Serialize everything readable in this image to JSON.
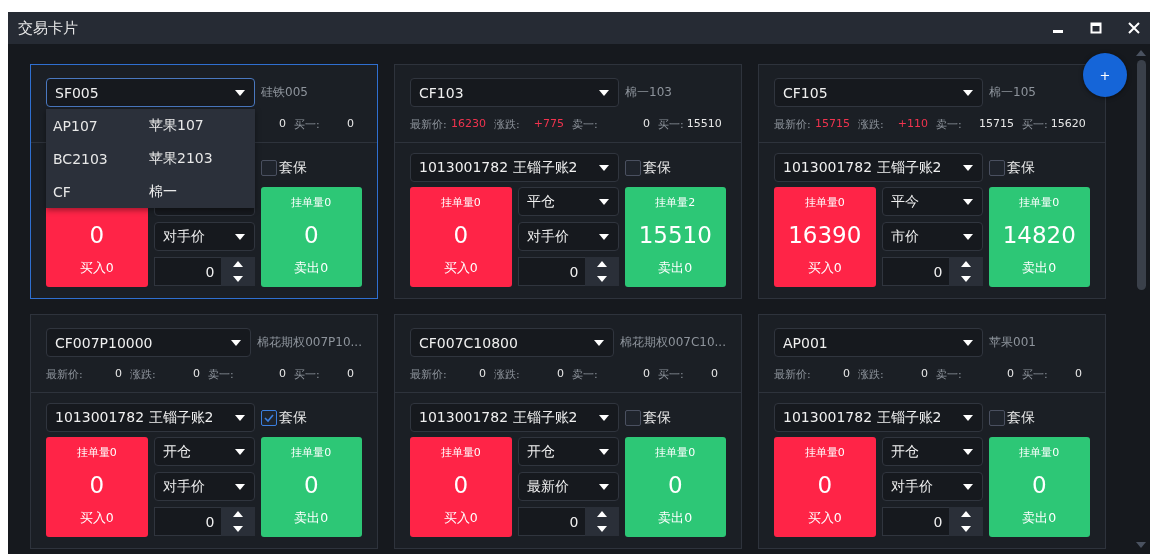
{
  "window": {
    "title": "交易卡片"
  },
  "fab": {
    "label": "+"
  },
  "cards": [
    {
      "selected": true,
      "symbol": "SF005",
      "name": "硅铁005",
      "quote": [
        {
          "value": "0",
          "rising": false
        },
        {
          "label": "买一:",
          "value": "0",
          "rising": false
        }
      ],
      "hedge": {
        "label": "套保",
        "checked": false
      },
      "buy": {
        "price": "0",
        "action": "买入0"
      },
      "price_type": "对手价",
      "quantity": "0",
      "sell": {
        "pending": "挂单量0",
        "price": "0",
        "action": "卖出0"
      },
      "dropdown": {
        "options": [
          {
            "code": "AP107",
            "name": "苹果107"
          },
          {
            "code": "BC2103",
            "name": "苹果2103"
          },
          {
            "code": "CF",
            "name": "棉一"
          }
        ]
      }
    },
    {
      "selected": false,
      "symbol": "CF103",
      "name": "棉一103",
      "quote": [
        {
          "label": "最新价:",
          "value": "16230",
          "rising": true
        },
        {
          "label": "涨跌:",
          "value": "+775",
          "rising": true
        },
        {
          "label": "卖一:",
          "value": "0",
          "rising": false
        },
        {
          "label": "买一:",
          "value": "15510",
          "rising": false
        }
      ],
      "account": "1013001782  王锱子账2",
      "hedge": {
        "label": "套保",
        "checked": false
      },
      "buy": {
        "pending": "挂单量0",
        "price": "0",
        "action": "买入0"
      },
      "open_type": "平仓",
      "price_type": "对手价",
      "quantity": "0",
      "sell": {
        "pending": "挂单量2",
        "price": "15510",
        "action": "卖出0"
      }
    },
    {
      "selected": false,
      "symbol": "CF105",
      "name": "棉一105",
      "quote": [
        {
          "label": "最新价:",
          "value": "15715",
          "rising": true
        },
        {
          "label": "涨跌:",
          "value": "+110",
          "rising": true
        },
        {
          "label": "卖一:",
          "value": "15715",
          "rising": false
        },
        {
          "label": "买一:",
          "value": "15620",
          "rising": false
        }
      ],
      "account": "1013001782  王锱子账2",
      "hedge": {
        "label": "套保",
        "checked": false
      },
      "buy": {
        "pending": "挂单量0",
        "price": "16390",
        "action": "买入0"
      },
      "open_type": "平今",
      "price_type": "市价",
      "quantity": "0",
      "sell": {
        "pending": "挂单量0",
        "price": "14820",
        "action": "卖出0"
      }
    },
    {
      "selected": false,
      "symbol": "CF007P10000",
      "name": "棉花期权007P10...",
      "quote": [
        {
          "label": "最新价:",
          "value": "0",
          "rising": false
        },
        {
          "label": "涨跌:",
          "value": "0",
          "rising": false
        },
        {
          "label": "卖一:",
          "value": "0",
          "rising": false
        },
        {
          "label": "买一:",
          "value": "0",
          "rising": false
        }
      ],
      "account": "1013001782  王锱子账2",
      "hedge": {
        "label": "套保",
        "checked": true
      },
      "buy": {
        "pending": "挂单量0",
        "price": "0",
        "action": "买入0"
      },
      "open_type": "开仓",
      "price_type": "对手价",
      "quantity": "0",
      "sell": {
        "pending": "挂单量0",
        "price": "0",
        "action": "卖出0"
      }
    },
    {
      "selected": false,
      "symbol": "CF007C10800",
      "name": "棉花期权007C10...",
      "quote": [
        {
          "label": "最新价:",
          "value": "0",
          "rising": false
        },
        {
          "label": "涨跌:",
          "value": "0",
          "rising": false
        },
        {
          "label": "卖一:",
          "value": "0",
          "rising": false
        },
        {
          "label": "买一:",
          "value": "0",
          "rising": false
        }
      ],
      "account": "1013001782  王锱子账2",
      "hedge": {
        "label": "套保",
        "checked": false
      },
      "buy": {
        "pending": "挂单量0",
        "price": "0",
        "action": "买入0"
      },
      "open_type": "开仓",
      "price_type": "最新价",
      "quantity": "0",
      "sell": {
        "pending": "挂单量0",
        "price": "0",
        "action": "卖出0"
      }
    },
    {
      "selected": false,
      "symbol": "AP001",
      "name": "苹果001",
      "quote": [
        {
          "label": "最新价:",
          "value": "0",
          "rising": false
        },
        {
          "label": "涨跌:",
          "value": "0",
          "rising": false
        },
        {
          "label": "卖一:",
          "value": "0",
          "rising": false
        },
        {
          "label": "买一:",
          "value": "0",
          "rising": false
        }
      ],
      "account": "1013001782  王锱子账2",
      "hedge": {
        "label": "套保",
        "checked": false
      },
      "buy": {
        "pending": "挂单量0",
        "price": "0",
        "action": "买入0"
      },
      "open_type": "开仓",
      "price_type": "对手价",
      "quantity": "0",
      "sell": {
        "pending": "挂单量0",
        "price": "0",
        "action": "卖出0"
      }
    }
  ]
}
